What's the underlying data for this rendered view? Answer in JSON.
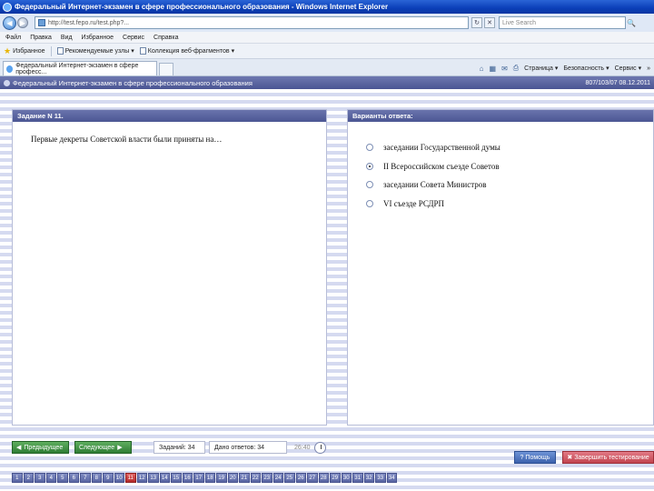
{
  "window": {
    "title": "Федеральный Интернет-экзамен в сфере профессионального образования - Windows Internet Explorer",
    "address": "http://test.fepo.ru/test.php?...",
    "search_placeholder": "Live Search"
  },
  "menu": [
    "Файл",
    "Правка",
    "Вид",
    "Избранное",
    "Сервис",
    "Справка"
  ],
  "favorites": {
    "label": "Избранное",
    "items": [
      "Рекомендуемые узлы",
      "Коллекция веб-фрагментов"
    ]
  },
  "tab": {
    "label": "Федеральный Интернет-экзамен в сфере професс..."
  },
  "commands": [
    "Страница",
    "Безопасность",
    "Сервис"
  ],
  "app": {
    "header": "Федеральный Интернет-экзамен в сфере профессионального образования",
    "session": "807/103/07 08.12.2011"
  },
  "question": {
    "heading": "Задание N 11.",
    "text": "Первые декреты Советской власти были приняты на…"
  },
  "answers": {
    "heading": "Варианты ответа:",
    "options": [
      {
        "label": "заседании Государственной думы",
        "selected": false
      },
      {
        "label": "II Всероссийском съезде Советов",
        "selected": true
      },
      {
        "label": "заседании Совета Министров",
        "selected": false
      },
      {
        "label": "VI съезде РСДРП",
        "selected": false
      }
    ]
  },
  "toolbar": {
    "prev": "Предыдущее",
    "next": "Следующее",
    "tasks_label": "Заданий: 34",
    "answered_label": "Дано ответов: 34",
    "time": "26:40",
    "help": "Помощь",
    "finish": "Завершить тестирование"
  },
  "pager": {
    "pages": [
      "1",
      "2",
      "3",
      "4",
      "5",
      "6",
      "7",
      "8",
      "9",
      "10",
      "11",
      "12",
      "13",
      "14",
      "15",
      "16",
      "17",
      "18",
      "19",
      "20",
      "21",
      "22",
      "23",
      "24",
      "25",
      "26",
      "27",
      "28",
      "29",
      "30",
      "31",
      "32",
      "33",
      "34"
    ],
    "current": "11"
  }
}
